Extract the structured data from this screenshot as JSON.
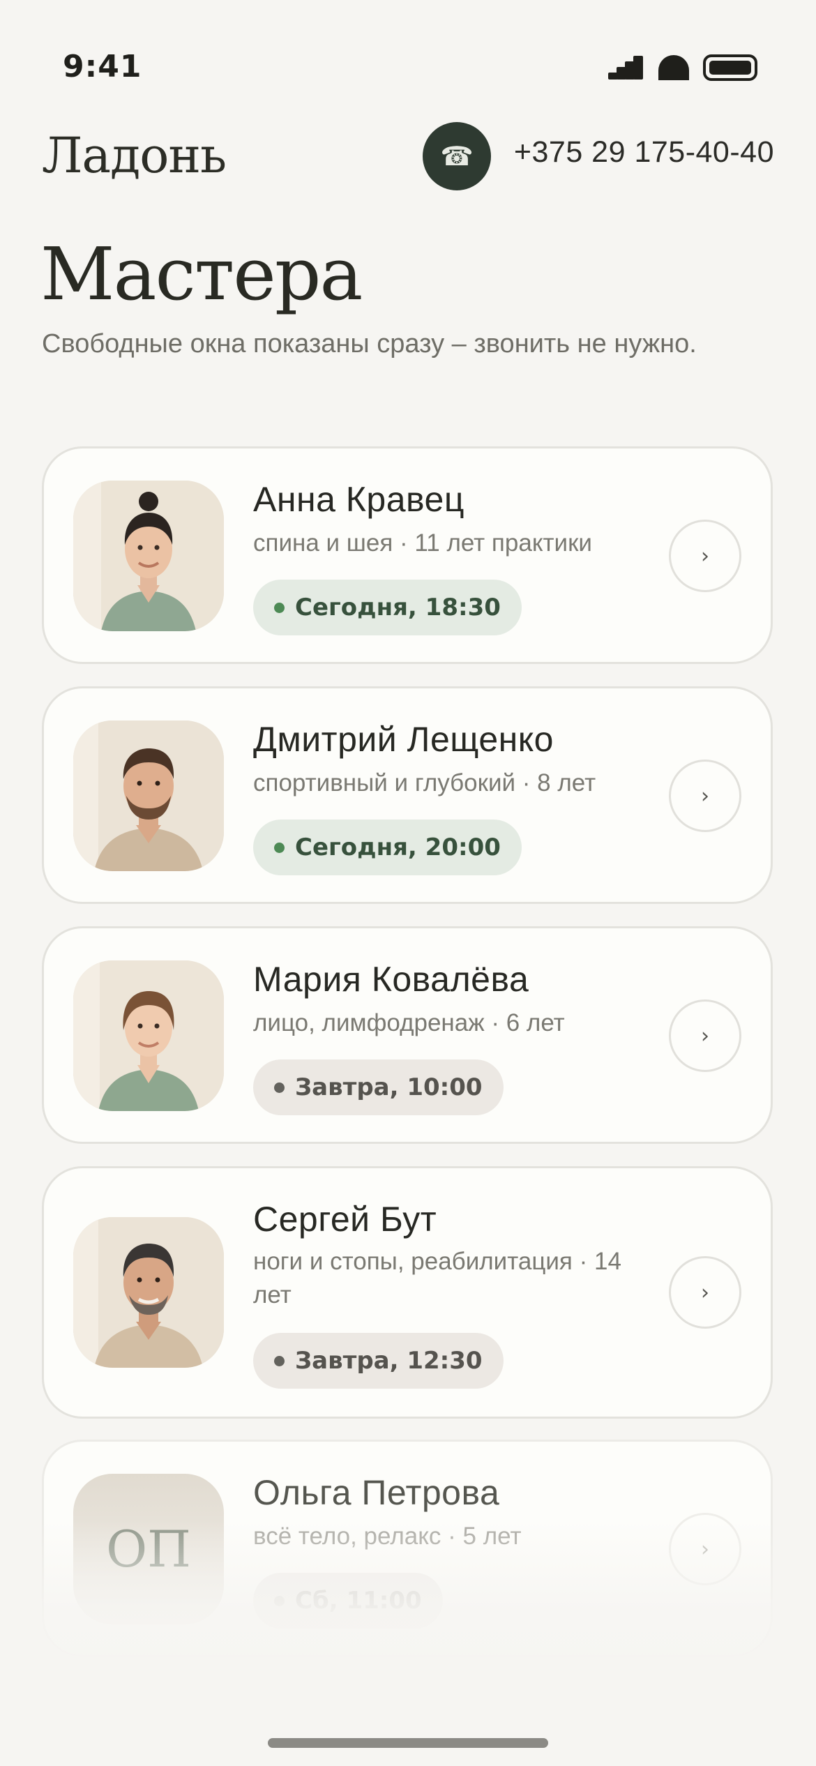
{
  "status_bar": {
    "time": "9:41"
  },
  "header": {
    "brand": "Ладонь",
    "phone_icon": "telephone-icon",
    "phone_number": "+375 29 175-40-40"
  },
  "main": {
    "title": "Мастера",
    "subtitle": "Свободные окна показаны сразу – звонить не нужно."
  },
  "masters": [
    {
      "name": "Анна Кравец",
      "spec": "спина и шея · 11 лет практики",
      "slot": "Сегодня, 18:30",
      "slot_type": "today"
    },
    {
      "name": "Дмитрий Лещенко",
      "spec": "спортивный и глубокий · 8 лет",
      "slot": "Сегодня, 20:00",
      "slot_type": "today"
    },
    {
      "name": "Мария Ковалёва",
      "spec": "лицо, лимфодренаж · 6 лет",
      "slot": "Завтра, 10:00",
      "slot_type": "later"
    },
    {
      "name": "Сергей Бут",
      "spec": "ноги и стопы, реабилитация · 14 лет",
      "slot": "Завтра, 12:30",
      "slot_type": "later"
    },
    {
      "name": "Ольга Петрова",
      "initials": "ОП",
      "spec": "всё тело, релакс · 5 лет",
      "slot": "Сб, 11:00",
      "slot_type": "later"
    }
  ],
  "arrow_glyph": "›",
  "colors": {
    "background": "#f6f5f2",
    "accent_dark": "#2e3a31",
    "today_badge_bg": "#e4ebe3",
    "today_dot": "#4d8a55",
    "later_badge_bg": "#ece8e3"
  }
}
